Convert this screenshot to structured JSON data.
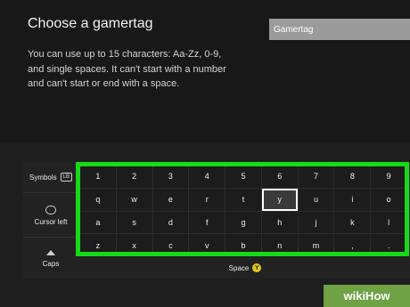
{
  "page": {
    "title": "Choose a gamertag",
    "help_text": "You can use up to 15 characters: Aa-Zz, 0-9, and single spaces. It can't start with a number and can't start or end with a space."
  },
  "gamertag": {
    "placeholder": "Gamertag",
    "value": ""
  },
  "side_keys": {
    "symbols_label": "Symbols",
    "symbols_glyph": "LB",
    "cursor_left_label": "Cursor left",
    "caps_label": "Caps"
  },
  "keyboard": {
    "rows": [
      [
        "1",
        "2",
        "3",
        "4",
        "5",
        "6",
        "7",
        "8",
        "9"
      ],
      [
        "q",
        "w",
        "e",
        "r",
        "t",
        "y",
        "u",
        "i",
        "o"
      ],
      [
        "a",
        "s",
        "d",
        "f",
        "g",
        "h",
        "j",
        "k",
        "l"
      ],
      [
        "z",
        "x",
        "c",
        "v",
        "b",
        "n",
        "m",
        ",",
        "."
      ]
    ],
    "selected_key": "y",
    "highlight_color": "#17d917"
  },
  "space_bar": {
    "label": "Space",
    "button_glyph": "Y",
    "button_color": "#e6c619"
  },
  "watermark": {
    "text": "wikiHow"
  }
}
